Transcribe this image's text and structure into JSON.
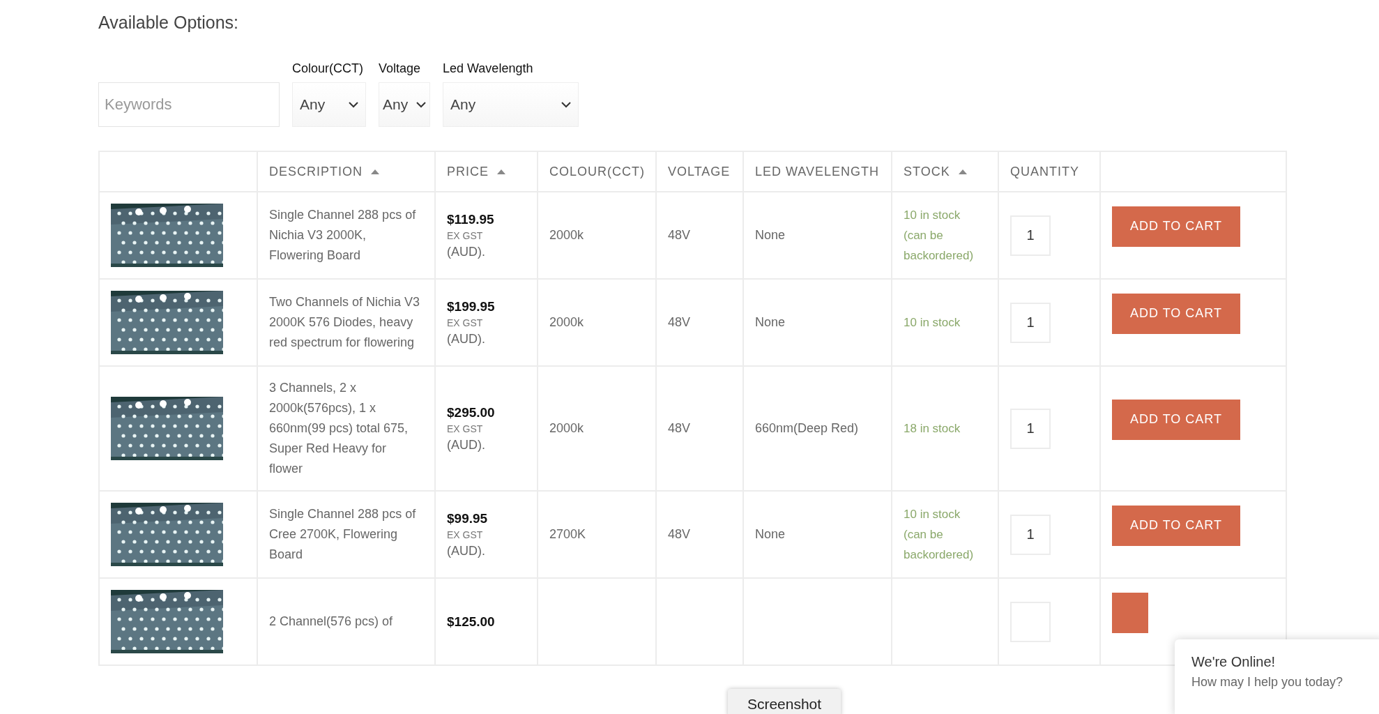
{
  "heading": "Available Options:",
  "filters": {
    "keywords": {
      "placeholder": "Keywords"
    },
    "selects": [
      {
        "label": "Colour(CCT)",
        "value": "Any"
      },
      {
        "label": "Voltage",
        "value": "Any"
      },
      {
        "label": "Led Wavelength",
        "value": "Any"
      }
    ]
  },
  "table": {
    "columns": [
      {
        "label": "DESCRIPTION",
        "sortable": true
      },
      {
        "label": "PRICE",
        "sortable": true
      },
      {
        "label": "COLOUR(CCT)",
        "sortable": false
      },
      {
        "label": "VOLTAGE",
        "sortable": false
      },
      {
        "label": "LED WAVELENGTH",
        "sortable": false
      },
      {
        "label": "STOCK",
        "sortable": true
      },
      {
        "label": "QUANTITY",
        "sortable": false
      }
    ],
    "rows": [
      {
        "description": "Single Channel 288 pcs of Nichia V3 2000K, Flowering Board",
        "price": "$119.95",
        "tax_note": "EX GST",
        "currency": "(AUD).",
        "colour": "2000k",
        "voltage": "48V",
        "wavelength": "None",
        "stock": "10 in stock (can be backordered)",
        "quantity": "1",
        "button": "ADD TO CART"
      },
      {
        "description": "Two Channels of Nichia V3 2000K 576 Diodes, heavy red spectrum for flowering",
        "price": "$199.95",
        "tax_note": "EX GST",
        "currency": "(AUD).",
        "colour": "2000k",
        "voltage": "48V",
        "wavelength": "None",
        "stock": "10 in stock",
        "quantity": "1",
        "button": "ADD TO CART"
      },
      {
        "description": "3 Channels, 2 x 2000k(576pcs), 1 x 660nm(99 pcs) total 675, Super Red Heavy for flower",
        "price": "$295.00",
        "tax_note": "EX GST",
        "currency": "(AUD).",
        "colour": "2000k",
        "voltage": "48V",
        "wavelength": "660nm(Deep Red)",
        "stock": "18 in stock",
        "quantity": "1",
        "button": "ADD TO CART"
      },
      {
        "description": "Single Channel 288 pcs of Cree 2700K, Flowering Board",
        "price": "$99.95",
        "tax_note": "EX GST",
        "currency": "(AUD).",
        "colour": "2700K",
        "voltage": "48V",
        "wavelength": "None",
        "stock": "10 in stock (can be backordered)",
        "quantity": "1",
        "button": "ADD TO CART"
      },
      {
        "description": "2 Channel(576 pcs) of",
        "price": "$125.00"
      }
    ]
  },
  "tooltip": "Screenshot",
  "chat": {
    "title": "We're Online!",
    "subtitle": "How may I help you today?"
  }
}
